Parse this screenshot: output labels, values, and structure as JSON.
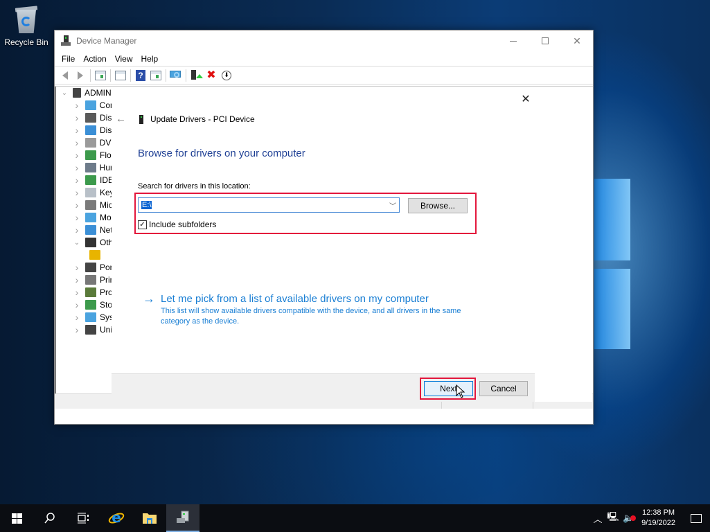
{
  "desktop": {
    "icons": [
      {
        "label": "Recycle Bin",
        "icon": "recycle-bin-icon"
      }
    ]
  },
  "window": {
    "title": "Device Manager",
    "controls": {
      "minimize": "minimize",
      "maximize": "maximize",
      "close": "✕"
    },
    "menu": [
      "File",
      "Action",
      "View",
      "Help"
    ],
    "toolbar": [
      "back-icon",
      "forward-icon",
      "show-hide-console-tree-icon",
      "properties-icon",
      "help-icon",
      "action-pane-icon",
      "scan-hardware-icon",
      "update-driver-icon",
      "uninstall-icon",
      "disable-device-icon"
    ],
    "tree": {
      "root": "ADMIN",
      "items": [
        {
          "label": "Com",
          "color": "#4aa3df",
          "expanded": false
        },
        {
          "label": "Disk",
          "color": "#5a5a5a",
          "expanded": false
        },
        {
          "label": "Disp",
          "color": "#3b8fd6",
          "expanded": false
        },
        {
          "label": "DVD",
          "color": "#9a9a9a",
          "expanded": false
        },
        {
          "label": "Flop",
          "color": "#3c9a4c",
          "expanded": false
        },
        {
          "label": "Hum",
          "color": "#6d7b8a",
          "expanded": false
        },
        {
          "label": "IDE",
          "color": "#3c9a4c",
          "expanded": false
        },
        {
          "label": "Key",
          "color": "#b8c0c8",
          "expanded": false
        },
        {
          "label": "Mic",
          "color": "#7a7a7a",
          "expanded": false
        },
        {
          "label": "Mo",
          "color": "#4aa3df",
          "expanded": false
        },
        {
          "label": "Net",
          "color": "#3b8fd6",
          "expanded": false
        },
        {
          "label": "Oth",
          "color": "#333333",
          "expanded": true
        },
        {
          "label": "",
          "color": "#e8b400",
          "child": true
        },
        {
          "label": "Por",
          "color": "#444444",
          "expanded": false
        },
        {
          "label": "Prin",
          "color": "#777777",
          "expanded": false
        },
        {
          "label": "Pro",
          "color": "#5a7a3a",
          "expanded": false
        },
        {
          "label": "Sto",
          "color": "#3c9a4c",
          "expanded": false
        },
        {
          "label": "Sys",
          "color": "#4aa3df",
          "expanded": false
        },
        {
          "label": "Uni",
          "color": "#444444",
          "expanded": false
        }
      ]
    }
  },
  "dialog": {
    "title": "Update Drivers - PCI Device",
    "heading": "Browse for drivers on your computer",
    "location_label": "Search for drivers in this location:",
    "location_value": "E:\\",
    "browse_label": "Browse...",
    "include_subfolders_label": "Include subfolders",
    "include_subfolders_checked": true,
    "pick_link": "Let me pick from a list of available drivers on my computer",
    "pick_desc": "This list will show available drivers compatible with the device, and all drivers in the same category as the device.",
    "next_label": "Next",
    "cancel_label": "Cancel",
    "close": "✕",
    "back": "←"
  },
  "taskbar": {
    "apps": [
      "start-icon",
      "search-icon",
      "task-view-icon",
      "internet-explorer-icon",
      "file-explorer-icon",
      "device-manager-icon"
    ],
    "clock_time": "12:38 PM",
    "clock_date": "9/19/2022"
  },
  "colors": {
    "highlight": "#e3163c",
    "link": "#1a7fd4",
    "heading": "#1e3f94"
  }
}
